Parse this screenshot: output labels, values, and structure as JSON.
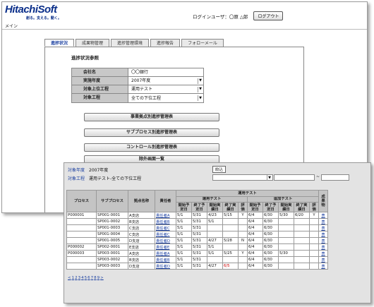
{
  "window1": {
    "logo": "HitachiSoft",
    "tagline": "創る。支える。動く。",
    "menu_label": "メイン",
    "user_label": "ログインユーザ：〇原 △郎",
    "logout": "ログアウト",
    "tabs": [
      "進捗状況",
      "成果物管理",
      "進捗管理環境",
      "進捗報告",
      "フォローメール"
    ],
    "section_title": "進捗状況参照",
    "form": [
      {
        "label": "会社名",
        "value": "〇〇銀行",
        "dropdown": false
      },
      {
        "label": "実施年度",
        "value": "2007年度",
        "dropdown": true
      },
      {
        "label": "対象上位工程",
        "value": "運用テスト",
        "dropdown": true
      },
      {
        "label": "対象工程",
        "value": "全ての下位工程",
        "dropdown": true
      }
    ],
    "buttons": [
      "事業拠点別進捗管理表",
      "サブプロセス別進捗管理表",
      "コントロール別進捗管理表",
      "除外画面一覧"
    ]
  },
  "window2": {
    "year_label": "対象年度",
    "year_value": "2007年度",
    "process_label": "対象工程",
    "process_value": "運用テスト-全ての下位工程",
    "narrow_btn": "絞込",
    "tilde": "~",
    "headers": {
      "process": "プロセス",
      "subprocess": "サブプロセス",
      "site": "拠点名称",
      "owner": "責任者",
      "group": "運用テスト",
      "sub1": "運用テスト",
      "sub2": "追加テスト",
      "cols": [
        "開始予定日",
        "終了予定日",
        "開始実績日",
        "終了実績日",
        "評価",
        "開始予定日",
        "終了予定日",
        "開始実績日",
        "終了実績日",
        "評価"
      ],
      "deliverable": "成果物"
    },
    "rows": [
      [
        "P000001",
        "SP001-0001",
        "A支店",
        "責任者A",
        "5/1",
        "5/31",
        "4/23",
        "5/15",
        "Y",
        "6/4",
        "6/30",
        "5/30",
        "6/20",
        "Y",
        "表"
      ],
      [
        "",
        "SP001-0002",
        "B支店",
        "責任者B",
        "5/1",
        "5/31",
        "5/1",
        "",
        "",
        "6/4",
        "6/30",
        "",
        "",
        "",
        "表"
      ],
      [
        "",
        "SP001-0003",
        "C支店",
        "責任者C",
        "5/1",
        "5/31",
        "",
        "",
        "",
        "6/4",
        "6/30",
        "",
        "",
        "",
        "表"
      ],
      [
        "",
        "SP001-0004",
        "C支店",
        "責任者C",
        "5/1",
        "5/31",
        "",
        "",
        "",
        "6/4",
        "6/30",
        "",
        "",
        "",
        "表"
      ],
      [
        "",
        "SP001-0005",
        "D支店",
        "責任者D",
        "5/1",
        "5/31",
        "4/27",
        "5/28",
        "N",
        "6/4",
        "6/30",
        "",
        "",
        "",
        "表"
      ],
      [
        "P000002",
        "SP002-0001",
        "E支店",
        "責任者E",
        "5/1",
        "5/31",
        "5/1",
        "",
        "",
        "6/4",
        "6/30",
        "",
        "",
        "",
        "表"
      ],
      [
        "P000003",
        "SP003-0001",
        "A支店",
        "責任者A",
        "5/1",
        "5/31",
        "5/1",
        "5/25",
        "Y",
        "6/4",
        "6/30",
        "5/30",
        "",
        "",
        "表"
      ],
      [
        "",
        "SP003-0002",
        "B支店",
        "責任者B",
        "5/1",
        "5/31",
        "",
        "",
        "",
        "6/4",
        "6/30",
        "",
        "",
        "",
        "表"
      ],
      [
        "",
        "SP003-0003",
        "D支店",
        "責任者D",
        "5/1",
        "5/31",
        "4/27",
        "6/5",
        "",
        "6/4",
        "6/30",
        "",
        "",
        "",
        "表"
      ]
    ],
    "pager": [
      "<",
      "1",
      "2",
      "3",
      "4",
      "5",
      "6",
      "7",
      "8",
      "9",
      ">"
    ]
  }
}
